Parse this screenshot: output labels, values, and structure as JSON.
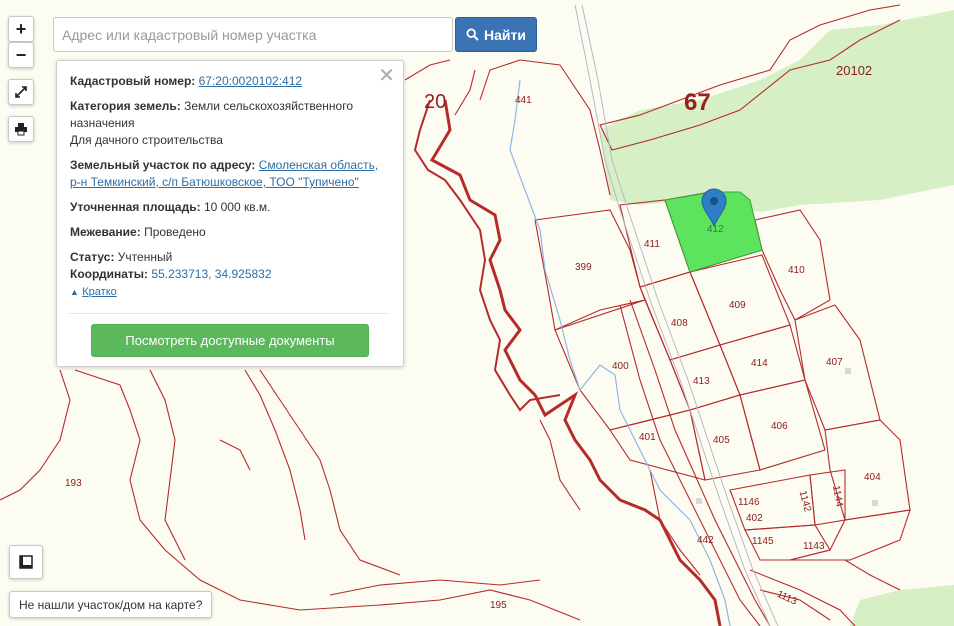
{
  "controls": {
    "zoom_in": "+",
    "zoom_out": "−"
  },
  "search": {
    "placeholder": "Адрес или кадастровый номер участка",
    "button_label": "Найти"
  },
  "info_panel": {
    "cadastral_label": "Кадастровый номер:",
    "cadastral_value": "67:20:0020102:412",
    "category_label": "Категория земель:",
    "category_value": "Земли сельскохозяйственного назначения",
    "usage_value": "Для дачного строительства",
    "address_label": "Земельный участок по адресу:",
    "address_value": "Смоленская область, р-н Темкинский, с/п Батюшковское, ТОО \"Тупичено\"",
    "area_label": "Уточненная площадь:",
    "area_value": "10 000 кв.м.",
    "survey_label": "Межевание:",
    "survey_value": "Проведено",
    "status_label": "Статус:",
    "status_value": "Учтенный",
    "coords_label": "Координаты:",
    "coords_value": "55.233713, 34.925832",
    "collapse_label": "Кратко",
    "docs_button": "Посмотреть доступные документы",
    "close": "✕"
  },
  "map_labels": {
    "district_20": "20",
    "district_67": "67",
    "block_20102": "20102",
    "p441": "441",
    "p412": "412",
    "p411": "411",
    "p410": "410",
    "p399": "399",
    "p409": "409",
    "p408": "408",
    "p414": "414",
    "p413": "413",
    "p407": "407",
    "p400": "400",
    "p406": "406",
    "p405": "405",
    "p401": "401",
    "p404": "404",
    "p1146": "1146",
    "p1142": "1142",
    "p1144": "1144",
    "p402": "402",
    "p442": "442",
    "p1145": "1145",
    "p1143": "1143",
    "p193": "193",
    "p195": "195",
    "p1113": "1113"
  },
  "footer": {
    "not_found": "Не нашли участок/дом на карте?"
  },
  "colors": {
    "boundary": "#b52b2b",
    "selected_parcel": "#5ee35e",
    "forest": "#d6efc4",
    "pin": "#2f7fc8",
    "primary_button": "#3b74b4",
    "success_button": "#5cb85c"
  }
}
